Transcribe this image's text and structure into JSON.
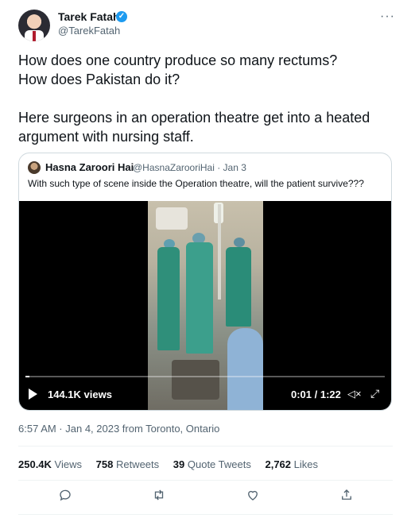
{
  "author": {
    "name": "Tarek Fatah",
    "handle": "@TarekFatah",
    "verified_mark": "✓"
  },
  "more_menu": "···",
  "tweet_text": {
    "line1": "How does one country produce so many rectums?",
    "line2": "How does Pakistan do it?",
    "line3": "Here surgeons in an operation theatre get into a heated argument with nursing staff."
  },
  "quoted_tweet": {
    "name": "Hasna Zaroori Hai",
    "handle_date": "@HasnaZarooriHai · Jan 3",
    "text": "With such type of scene inside the Operation theatre, will the patient survive???",
    "video": {
      "views": "144.1K views",
      "time": "0:01 / 1:22",
      "progress": 0.012
    }
  },
  "timestamp": "6:57 AM · Jan 4, 2023 from Toronto, Ontario",
  "stats": {
    "views_count": "250.4K",
    "views_label": "Views",
    "retweets_count": "758",
    "retweets_label": "Retweets",
    "quotes_count": "39",
    "quotes_label": "Quote Tweets",
    "likes_count": "2,762",
    "likes_label": "Likes"
  },
  "colors": {
    "accent": "#1d9bf0",
    "secondary_text": "#536471",
    "border": "#cfd9de"
  },
  "icons": [
    "reply-icon",
    "retweet-icon",
    "like-icon",
    "share-icon",
    "play-icon",
    "mute-icon",
    "fullscreen-icon"
  ]
}
